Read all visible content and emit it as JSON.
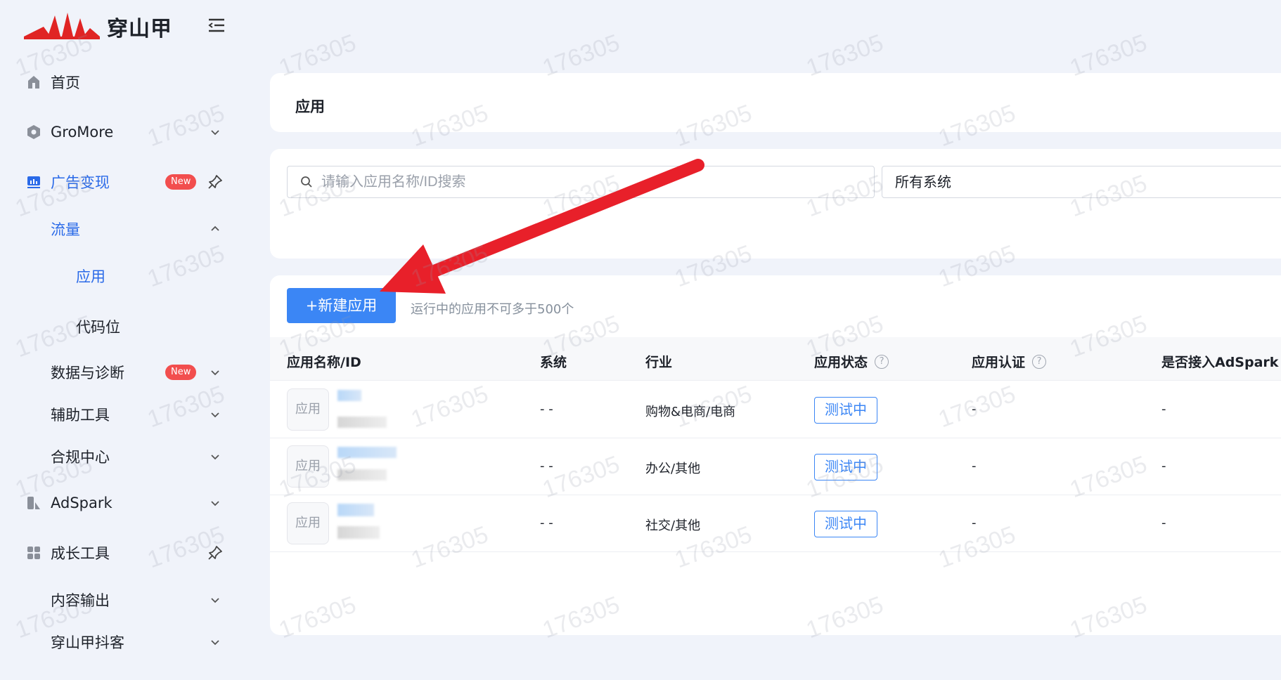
{
  "brand": {
    "name": "穿山甲",
    "accent": "#e02424"
  },
  "sidebar": {
    "items": [
      {
        "label": "首页",
        "icon": "home-icon"
      },
      {
        "label": "GroMore",
        "icon": "hexagon-icon"
      },
      {
        "label": "广告变现",
        "icon": "chart-icon",
        "badge": "New"
      },
      {
        "label": "流量"
      },
      {
        "label": "应用"
      },
      {
        "label": "代码位"
      },
      {
        "label": "数据与诊断",
        "badge": "New"
      },
      {
        "label": "辅助工具"
      },
      {
        "label": "合规中心"
      },
      {
        "label": "AdSpark",
        "icon": "adspark-icon"
      },
      {
        "label": "成长工具",
        "icon": "grid-icon"
      },
      {
        "label": "内容输出"
      },
      {
        "label": "穿山甲抖客"
      }
    ]
  },
  "page": {
    "title": "应用"
  },
  "filters": {
    "search_placeholder": "请输入应用名称/ID搜索",
    "system_select": "所有系统"
  },
  "toolbar": {
    "new_app_label": "+新建应用",
    "limit_hint": "运行中的应用不可多于500个"
  },
  "table": {
    "columns": [
      "应用名称/ID",
      "系统",
      "行业",
      "应用状态",
      "应用认证",
      "是否接入AdSpark"
    ],
    "rows": [
      {
        "thumb": "应用",
        "system": "- -",
        "industry": "购物&电商/电商",
        "status": "测试中",
        "cert": "-",
        "adspark": "-"
      },
      {
        "thumb": "应用",
        "system": "- -",
        "industry": "办公/其他",
        "status": "测试中",
        "cert": "-",
        "adspark": "-"
      },
      {
        "thumb": "应用",
        "system": "- -",
        "industry": "社交/其他",
        "status": "测试中",
        "cert": "-",
        "adspark": "-"
      }
    ]
  },
  "watermark": "176305",
  "colors": {
    "primary": "#3b86f5",
    "active_nav": "#2a6ae8",
    "badge": "#f24e4e",
    "arrow": "#e8202a"
  }
}
